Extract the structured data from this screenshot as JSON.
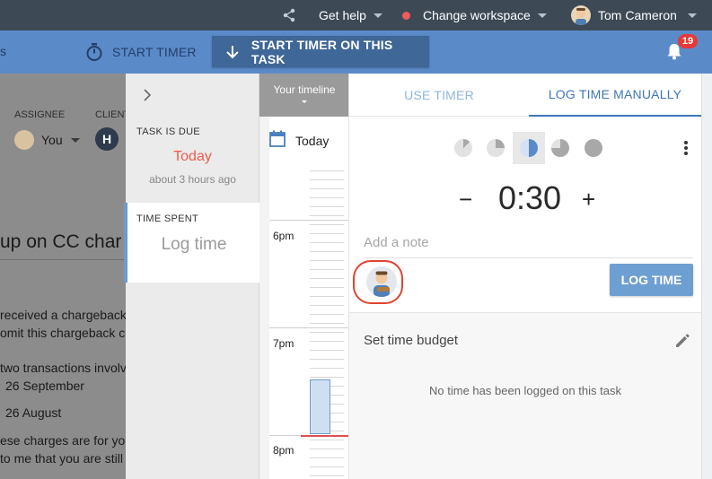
{
  "topbar": {
    "help_label": "Get help",
    "workspace_label": "Change workspace",
    "user_name": "Tom Cameron"
  },
  "toolbar": {
    "left_fragment": "s",
    "start_timer_label": "START TIMER",
    "start_timer_task_label": "START TIMER ON THIS TASK",
    "notification_count": "19"
  },
  "background_page": {
    "assignee_header": "ASSIGNEE",
    "assignee_value": "You",
    "client_header": "CLIENT",
    "client_avatar_letter": "H",
    "title_fragment": "up on CC char",
    "lines": [
      "received a chargeback",
      "omit this chargeback c",
      "two transactions involv",
      "26 September",
      "26 August",
      "ese charges are for you",
      "to me that you are still"
    ]
  },
  "task_panel": {
    "task_due_label": "TASK IS DUE",
    "due_value": "Today",
    "due_relative": "about 3 hours ago",
    "time_spent_label": "TIME SPENT",
    "time_spent_value": "Log time"
  },
  "timeline": {
    "header": "Your timeline",
    "today_label": "Today",
    "hours": [
      "6pm",
      "7pm",
      "8pm"
    ]
  },
  "log_panel": {
    "tabs": [
      {
        "label": "USE TIMER",
        "active": false
      },
      {
        "label": "LOG TIME MANUALLY",
        "active": true
      }
    ],
    "duration": "0:30",
    "minus_symbol": "−",
    "plus_symbol": "+",
    "note_placeholder": "Add a note",
    "log_button_label": "LOG TIME",
    "budget_label": "Set time budget",
    "empty_message": "No time has been logged on this task"
  },
  "colors": {
    "topbar_bg": "#3d4a56",
    "toolbar_bg": "#5b8ac9",
    "accent": "#6a9bd1",
    "due_red": "#f05a4c",
    "log_button": "#6e9fd2"
  }
}
